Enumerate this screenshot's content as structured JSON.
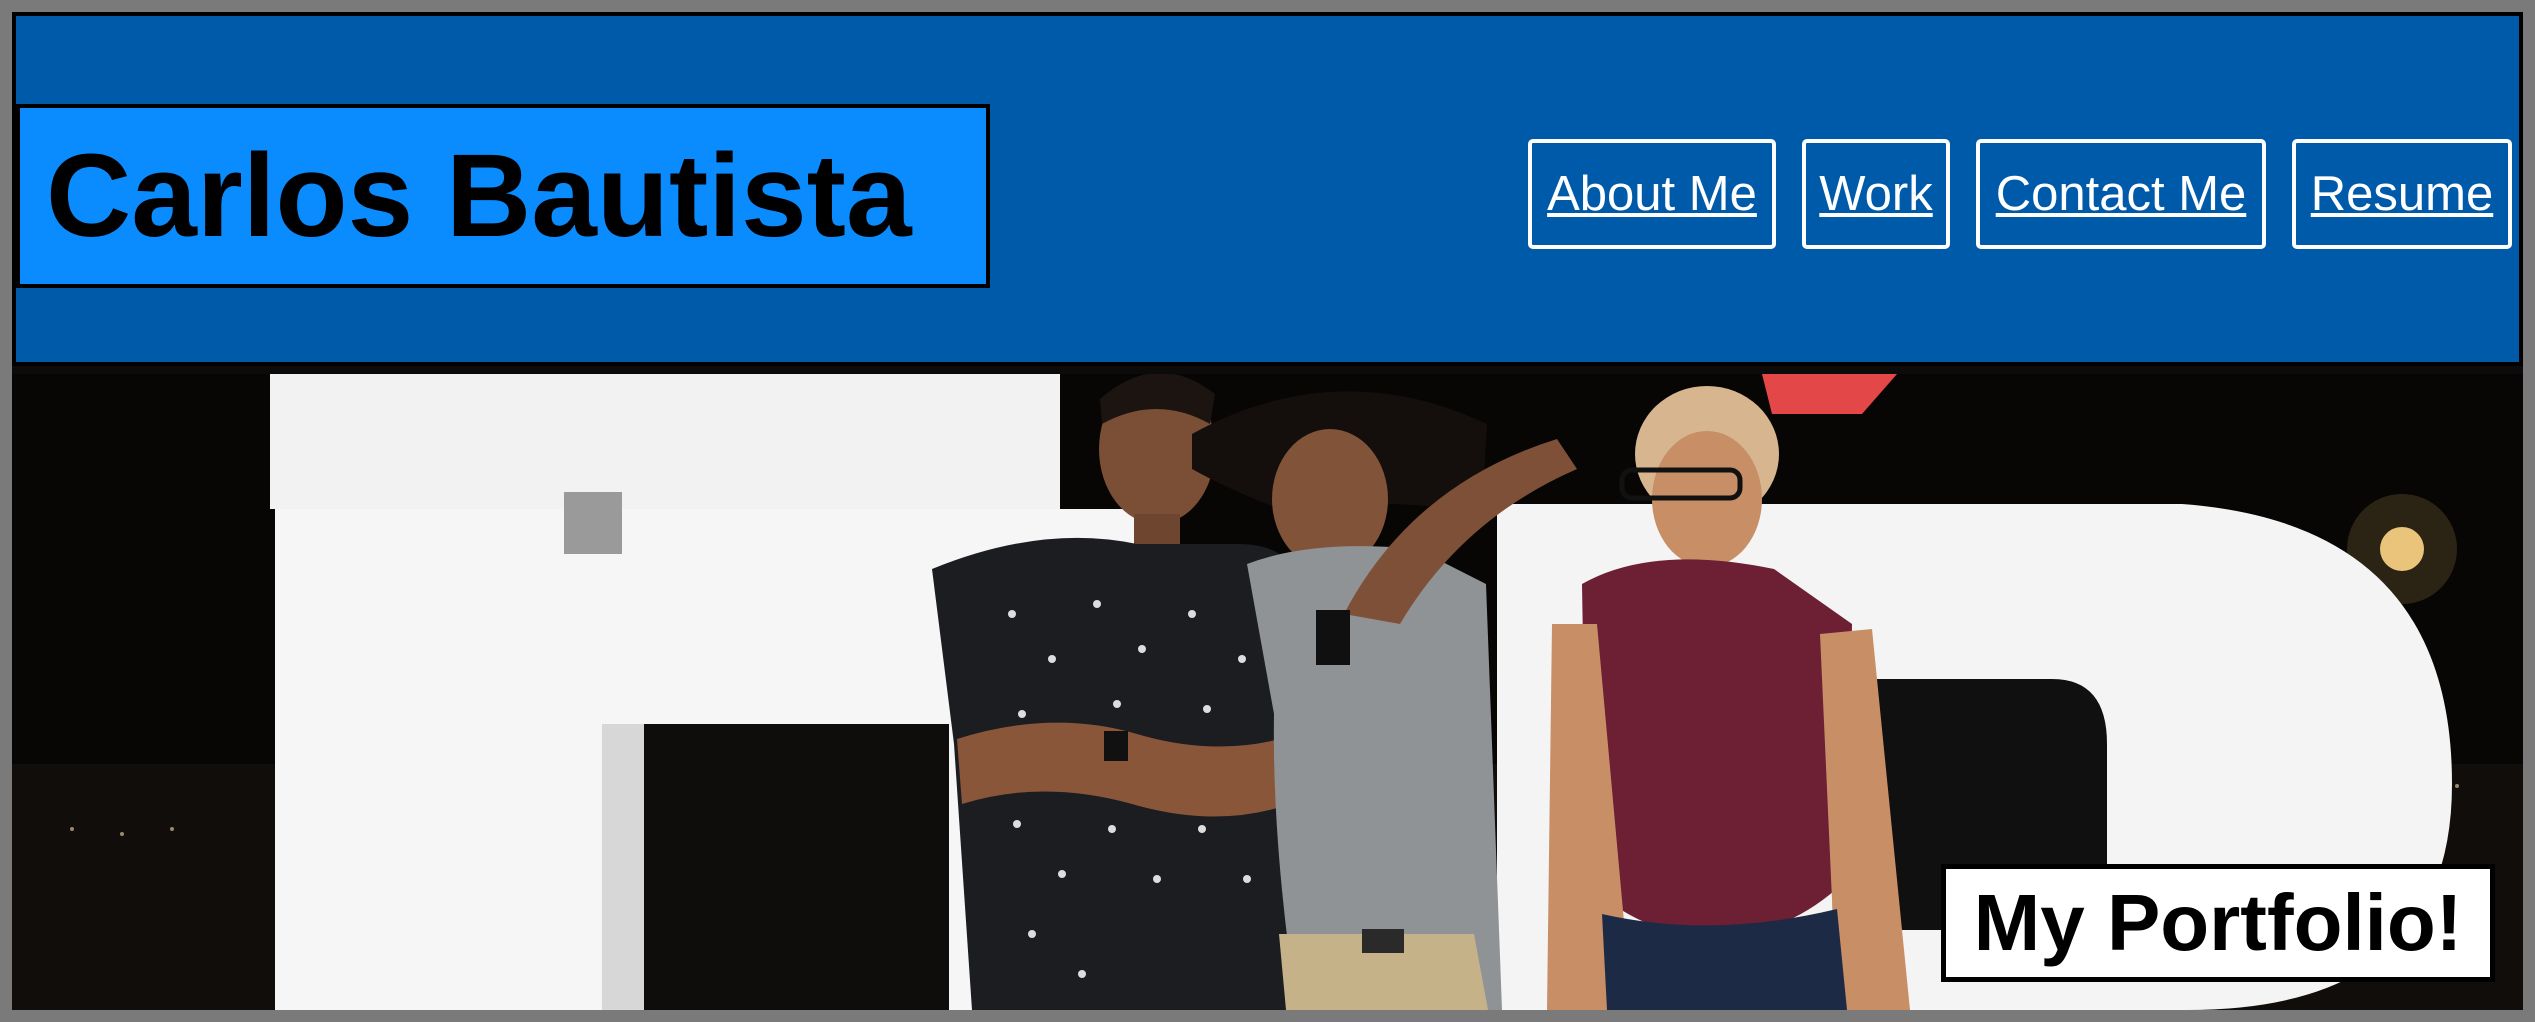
{
  "header": {
    "site_title": "Carlos Bautista",
    "nav": [
      {
        "label": "About Me"
      },
      {
        "label": "Work"
      },
      {
        "label": "Contact Me"
      },
      {
        "label": "Resume"
      }
    ]
  },
  "hero": {
    "image_alt": "Group photo at night in front of large white letters",
    "caption": "My Portfolio!"
  },
  "colors": {
    "header_bg": "#005aaa",
    "brand_bg": "#0a8cff",
    "nav_text": "#ffffff"
  }
}
